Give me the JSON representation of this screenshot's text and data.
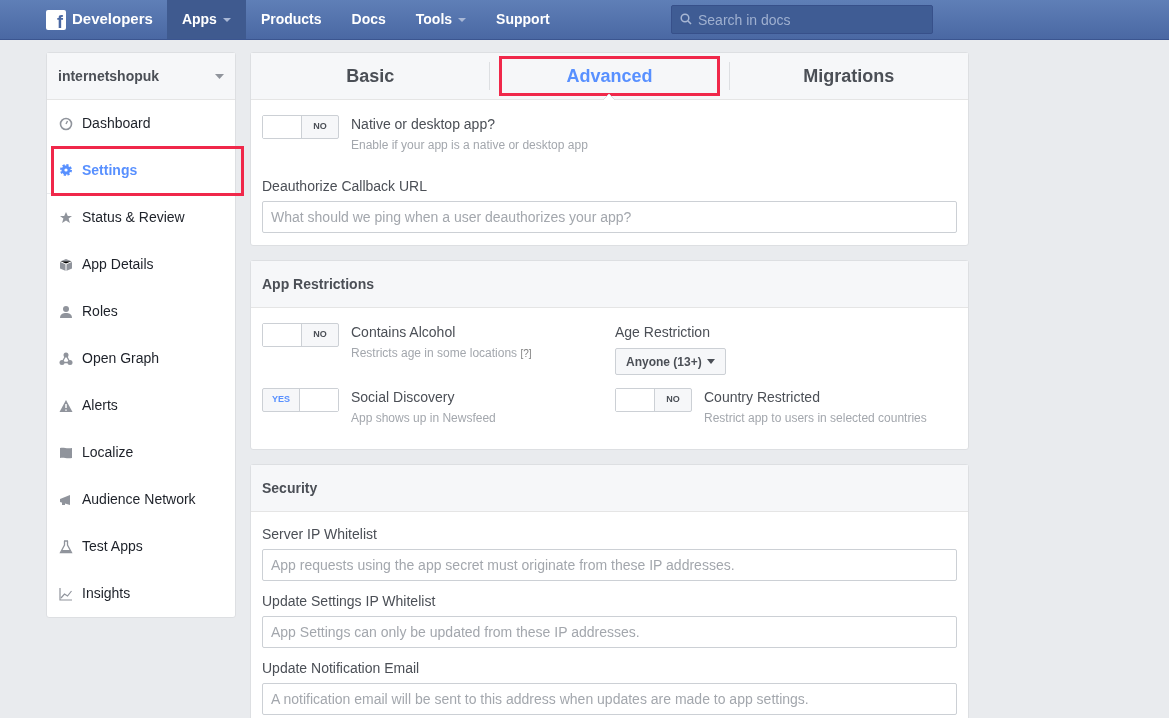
{
  "topbar": {
    "logo": "f",
    "brand": "Developers",
    "nav": [
      {
        "label": "Apps",
        "selected": true,
        "dropdown": true
      },
      {
        "label": "Products",
        "selected": false,
        "dropdown": false
      },
      {
        "label": "Docs",
        "selected": false,
        "dropdown": false
      },
      {
        "label": "Tools",
        "selected": false,
        "dropdown": true
      },
      {
        "label": "Support",
        "selected": false,
        "dropdown": false
      }
    ],
    "search": {
      "placeholder": "Search in docs"
    }
  },
  "sidebar": {
    "app_name": "internetshopuk",
    "items": [
      {
        "label": "Dashboard",
        "kind": "dashboard",
        "selected": false,
        "highlighted": false
      },
      {
        "label": "Settings",
        "kind": "gear",
        "selected": true,
        "highlighted": true
      },
      {
        "label": "Status & Review",
        "kind": "star",
        "selected": false,
        "highlighted": false
      },
      {
        "label": "App Details",
        "kind": "cube",
        "selected": false,
        "highlighted": false
      },
      {
        "label": "Roles",
        "kind": "person",
        "selected": false,
        "highlighted": false
      },
      {
        "label": "Open Graph",
        "kind": "graph",
        "selected": false,
        "highlighted": false
      },
      {
        "label": "Alerts",
        "kind": "warning",
        "selected": false,
        "highlighted": false
      },
      {
        "label": "Localize",
        "kind": "flag",
        "selected": false,
        "highlighted": false
      },
      {
        "label": "Audience Network",
        "kind": "megaphone",
        "selected": false,
        "highlighted": false
      },
      {
        "label": "Test Apps",
        "kind": "flask",
        "selected": false,
        "highlighted": false
      },
      {
        "label": "Insights",
        "kind": "chart",
        "selected": false,
        "highlighted": false
      }
    ]
  },
  "tabs": [
    {
      "label": "Basic",
      "selected": false,
      "highlighted": false
    },
    {
      "label": "Advanced",
      "selected": true,
      "highlighted": true
    },
    {
      "label": "Migrations",
      "selected": false,
      "highlighted": false
    }
  ],
  "advanced": {
    "native_app": {
      "title": "Native or desktop app?",
      "hint": "Enable if your app is a native or desktop app",
      "on": false,
      "state_label": "NO"
    },
    "deauthorize": {
      "label": "Deauthorize Callback URL",
      "placeholder": "What should we ping when a user deauthorizes your app?"
    }
  },
  "app_restrictions": {
    "title": "App Restrictions",
    "contains_alcohol": {
      "title": "Contains Alcohol",
      "hint": "Restricts age in some locations",
      "help": "[?]",
      "on": false,
      "state_label": "NO"
    },
    "age_restriction": {
      "label": "Age Restriction",
      "value": "Anyone (13+)"
    },
    "social_discovery": {
      "title": "Social Discovery",
      "hint": "App shows up in Newsfeed",
      "on": true,
      "state_label": "YES"
    },
    "country_restricted": {
      "title": "Country Restricted",
      "hint": "Restrict app to users in selected countries",
      "on": false,
      "state_label": "NO"
    }
  },
  "security": {
    "title": "Security",
    "fields": [
      {
        "label": "Server IP Whitelist",
        "placeholder": "App requests using the app secret must originate from these IP addresses."
      },
      {
        "label": "Update Settings IP Whitelist",
        "placeholder": "App Settings can only be updated from these IP addresses."
      },
      {
        "label": "Update Notification Email",
        "placeholder": "A notification email will be sent to this address when updates are made to app settings."
      }
    ]
  }
}
